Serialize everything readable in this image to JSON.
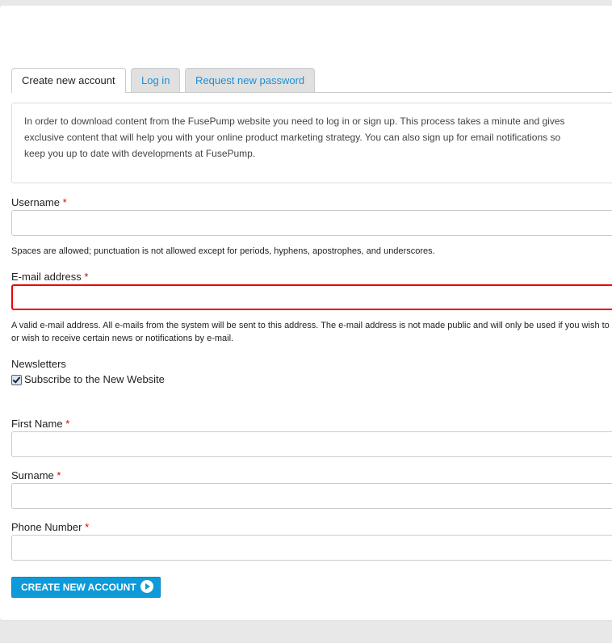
{
  "tabs": [
    "Create new account",
    "Log in",
    "Request new password"
  ],
  "intro": [
    "In order to download content from the FusePump website you need to log in or sign up. This process takes a minute and gives",
    "exclusive content that will help you with your online product marketing strategy. You can also sign up for email notifications so",
    "keep you up to date with developments at FusePump."
  ],
  "username": {
    "label": "Username",
    "required": "*",
    "value": "",
    "help": "Spaces are allowed; punctuation is not allowed except for periods, hyphens, apostrophes, and underscores."
  },
  "email": {
    "label": "E-mail address",
    "required": "*",
    "value": "",
    "help1": "A valid e-mail address. All e-mails from the system will be sent to this address. The e-mail address is not made public and will only be used if you wish to re",
    "help2": "or wish to receive certain news or notifications by e-mail."
  },
  "newsletters": {
    "label": "Newsletters",
    "option": "Subscribe to the New Website",
    "checked": true
  },
  "first_name": {
    "label": "First Name",
    "required": "*",
    "value": ""
  },
  "surname": {
    "label": "Surname",
    "required": "*",
    "value": ""
  },
  "phone": {
    "label": "Phone Number",
    "required": "*",
    "value": ""
  },
  "submit": "CREATE NEW ACCOUNT"
}
